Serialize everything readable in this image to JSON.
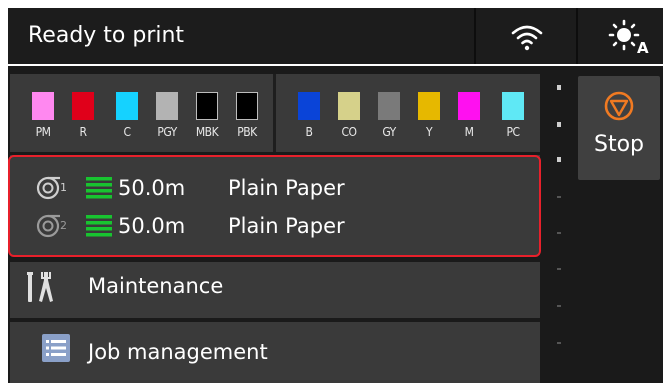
{
  "header": {
    "status_text": "Ready to print",
    "wifi_icon": "wifi-icon",
    "mode_icon": "auto-brightness-icon"
  },
  "inks": [
    {
      "label": "PM",
      "color": "#ff88f0"
    },
    {
      "label": "R",
      "color": "#e0001a"
    },
    {
      "label": "C",
      "color": "#15d2ff"
    },
    {
      "label": "PGY",
      "color": "#b3b3b3"
    },
    {
      "label": "MBK",
      "color": "#000000"
    },
    {
      "label": "PBK",
      "color": "#000000"
    },
    {
      "label": "B",
      "color": "#0a44d8"
    },
    {
      "label": "CO",
      "color": "#d6d18a"
    },
    {
      "label": "GY",
      "color": "#7a7a7a"
    },
    {
      "label": "Y",
      "color": "#e6b800"
    },
    {
      "label": "M",
      "color": "#ff10f0"
    },
    {
      "label": "PC",
      "color": "#5fe8f5"
    }
  ],
  "paper": [
    {
      "roll": "1",
      "length": "50.0m",
      "type": "Plain Paper",
      "level_color": "#18c430"
    },
    {
      "roll": "2",
      "length": "50.0m",
      "type": "Plain Paper",
      "level_color": "#18c430"
    }
  ],
  "menu": {
    "maintenance_label": "Maintenance",
    "job_management_label": "Job management"
  },
  "stop": {
    "label": "Stop",
    "icon_color": "#f07a22"
  },
  "colors": {
    "highlight_border": "#e8202b"
  }
}
